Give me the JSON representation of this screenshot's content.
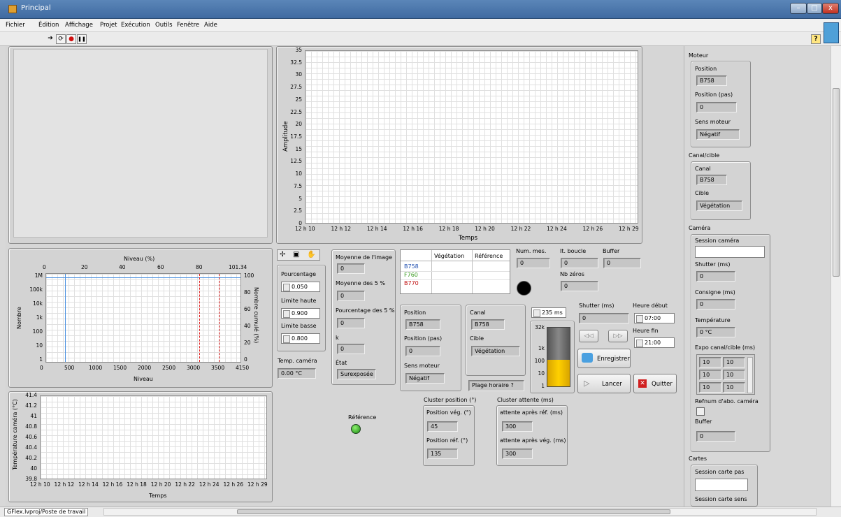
{
  "window": {
    "title": "Principal",
    "min": "–",
    "max": "□",
    "close": "x"
  },
  "menu": [
    "Fichier",
    "Édition",
    "Affichage",
    "Projet",
    "Exécution",
    "Outils",
    "Fenêtre",
    "Aide"
  ],
  "toolbar": {
    "run": "➔",
    "run_cont": "⟳",
    "abort": "●",
    "pause": "❚❚",
    "help": "?"
  },
  "amplitude_chart": {
    "type": "line",
    "ylabel": "Amplitude",
    "xlabel": "Temps",
    "ylim": [
      0,
      35
    ],
    "yticks": [
      "35",
      "32.5",
      "30",
      "27.5",
      "25",
      "22.5",
      "20",
      "17.5",
      "15",
      "12.5",
      "10",
      "7.5",
      "5",
      "2.5",
      "0"
    ],
    "xticks": [
      "12 h 10",
      "12 h 12",
      "12 h 14",
      "12 h 16",
      "12 h 18",
      "12 h 20",
      "12 h 22",
      "12 h 24",
      "12 h 26",
      "12 h 29"
    ],
    "series": []
  },
  "histogram": {
    "top_title": "Niveau (%)",
    "top_ticks": [
      "0",
      "20",
      "40",
      "60",
      "80",
      "101.34"
    ],
    "xlabel": "Niveau",
    "xticks": [
      "0",
      "500",
      "1000",
      "1500",
      "2000",
      "2500",
      "3000",
      "3500",
      "4150"
    ],
    "ylabel": "Nombre",
    "yticks": [
      "1M",
      "100k",
      "10k",
      "1k",
      "100",
      "10",
      "1"
    ],
    "y2label": "Nombre cumulé (%)",
    "y2ticks": [
      "100",
      "80",
      "60",
      "40",
      "20",
      "0"
    ]
  },
  "temp_chart": {
    "type": "line",
    "ylabel": "Température caméra (°C)",
    "xlabel": "Temps",
    "yticks": [
      "41.4",
      "41.2",
      "41",
      "40.8",
      "40.6",
      "40.4",
      "40.2",
      "40",
      "39.8"
    ],
    "xticks": [
      "12 h 10",
      "12 h 12",
      "12 h 14",
      "12 h 16",
      "12 h 18",
      "12 h 20",
      "12 h 22",
      "12 h 24",
      "12 h 26",
      "12 h 29"
    ]
  },
  "tools": [
    "✢",
    "▣",
    "✋"
  ],
  "pourcentage": {
    "label": "Pourcentage",
    "value": "0.050"
  },
  "limite_haute": {
    "label": "Limite haute",
    "value": "0.900"
  },
  "limite_basse": {
    "label": "Limite basse",
    "value": "0.800"
  },
  "temp_camera": {
    "label": "Temp. caméra",
    "value": "0.00 °C"
  },
  "stats": {
    "moyenne_image_label": "Moyenne de l'image",
    "moyenne_image": "0",
    "moyenne5_label": "Moyenne des 5 %",
    "moyenne5": "0",
    "pourcentage5_label": "Pourcentage des 5 %",
    "pourcentage5": "0",
    "k_label": "k",
    "k": "0",
    "etat_label": "État",
    "etat": "Surexposée"
  },
  "table": {
    "headers": [
      "",
      "Végétation",
      "Référence"
    ],
    "rows": [
      {
        "name": "B758",
        "color": "#1f4fb0"
      },
      {
        "name": "F760",
        "color": "#3a9a20"
      },
      {
        "name": "B770",
        "color": "#c01010"
      }
    ]
  },
  "counters": {
    "num_mes_label": "Num. mes.",
    "num_mes": "0",
    "it_boucle_label": "It. boucle",
    "it_boucle": "0",
    "buffer_label": "Buffer",
    "buffer": "0",
    "nb_zeros_label": "Nb zéros",
    "nb_zeros": "0"
  },
  "position_panel": {
    "position_label": "Position",
    "position": "B758",
    "position_pas_label": "Position (pas)",
    "position_pas": "0",
    "sens_label": "Sens moteur",
    "sens": "Négatif"
  },
  "canal_panel": {
    "canal_label": "Canal",
    "canal": "B758",
    "cible_label": "Cible",
    "cible": "Végétation"
  },
  "plage_horaire": "Plage horaire ?",
  "exposure": {
    "value": "235 ms",
    "gauge_ticks": [
      "32k",
      "1k",
      "100",
      "10",
      "1"
    ],
    "gauge_fill": 0.45
  },
  "shutter": {
    "label": "Shutter (ms)",
    "value": "0"
  },
  "heure_debut": {
    "label": "Heure début",
    "value": "07:00"
  },
  "heure_fin": {
    "label": "Heure fin",
    "value": "21:00"
  },
  "buttons": {
    "prev": "◁◁",
    "next": "▷▷",
    "enregistrer": "Enregistrer",
    "lancer": "Lancer",
    "quitter": "Quitter"
  },
  "reference_led": "Référence",
  "cluster_position": {
    "title": "Cluster position (°)",
    "veg_label": "Position vég. (°)",
    "veg": "45",
    "ref_label": "Position réf. (°)",
    "ref": "135"
  },
  "cluster_attente": {
    "title": "Cluster attente (ms)",
    "apres_ref_label": "attente après réf. (ms)",
    "apres_ref": "300",
    "apres_veg_label": "attente après vég. (ms)",
    "apres_veg": "300"
  },
  "moteur": {
    "title": "Moteur",
    "position_label": "Position",
    "position": "B758",
    "position_pas_label": "Position (pas)",
    "position_pas": "0",
    "sens_label": "Sens moteur",
    "sens": "Négatif"
  },
  "canal_cible": {
    "title": "Canal/cible",
    "canal_label": "Canal",
    "canal": "B758",
    "cible_label": "Cible",
    "cible": "Végétation"
  },
  "camera": {
    "title": "Caméra",
    "session_label": "Session caméra",
    "shutter_label": "Shutter (ms)",
    "shutter": "0",
    "consigne_label": "Consigne (ms)",
    "consigne": "0",
    "temperature_label": "Température",
    "temperature": "0 °C",
    "expo_label": "Expo canal/cible (ms)",
    "expo": [
      [
        "10",
        "10"
      ],
      [
        "10",
        "10"
      ],
      [
        "10",
        "10"
      ]
    ],
    "refnum_label": "Refnum d'abo. caméra",
    "buffer_label": "Buffer",
    "buffer": "0"
  },
  "cartes": {
    "title": "Cartes",
    "session_pas_label": "Session carte pas",
    "session_sens_label": "Session carte sens"
  },
  "status": {
    "project": "GFlex.lvproj/Poste de travail"
  }
}
